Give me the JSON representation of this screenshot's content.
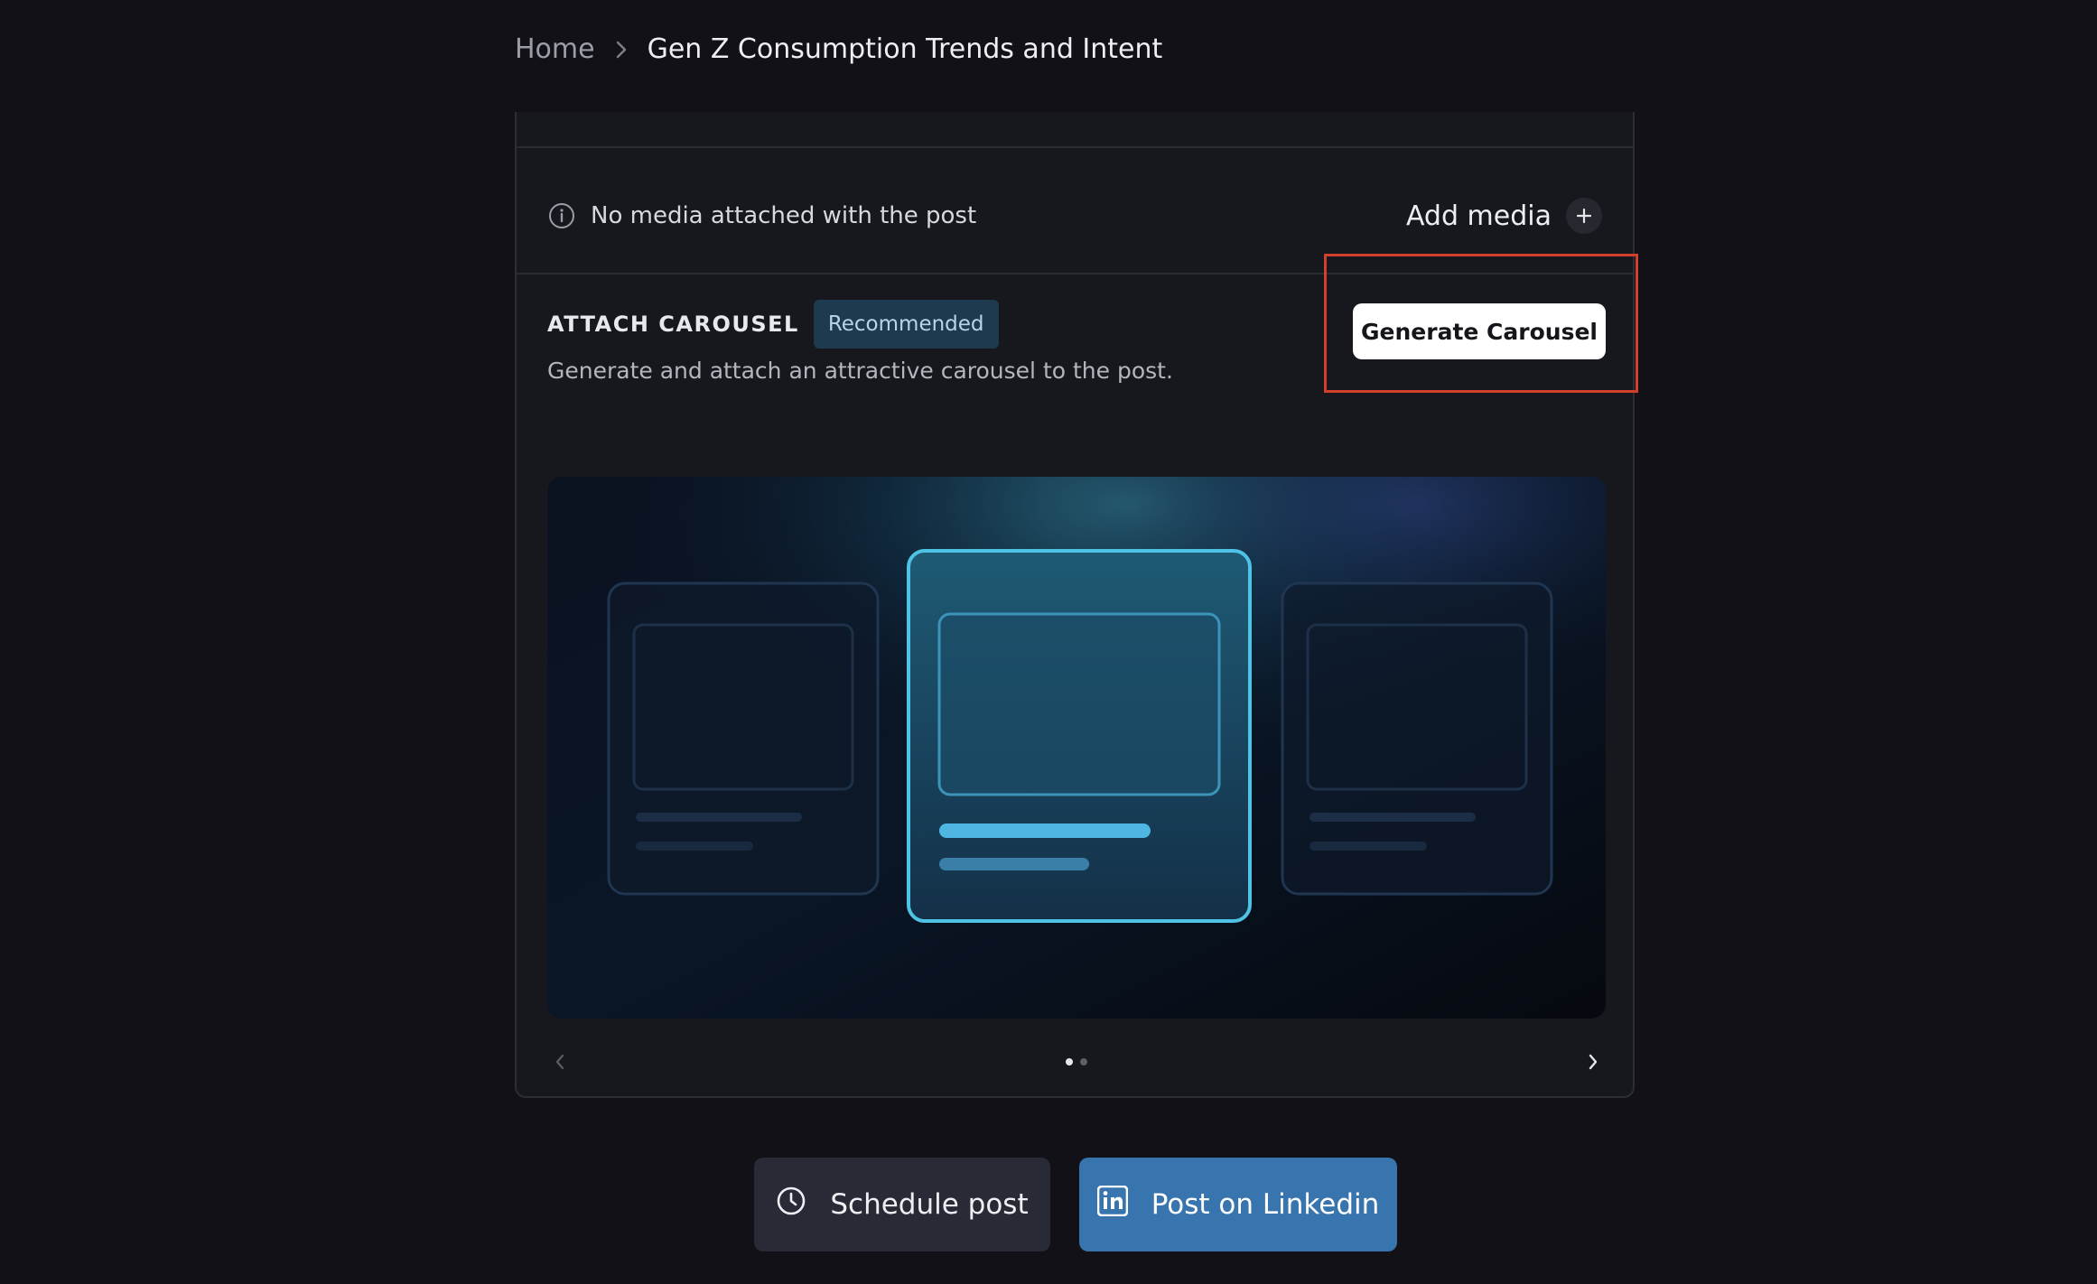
{
  "breadcrumb": {
    "home": "Home",
    "current": "Gen Z Consumption Trends and Intent"
  },
  "media": {
    "notice": "No media attached with the post",
    "add_label": "Add media"
  },
  "carousel": {
    "title": "ATTACH CAROUSEL",
    "badge": "Recommended",
    "description": "Generate and attach an attractive carousel to the post.",
    "generate_label": "Generate Carousel",
    "pages_total": 2,
    "page_current": 1
  },
  "actions": {
    "schedule_label": "Schedule post",
    "linkedin_label": "Post on Linkedin"
  },
  "icons": {
    "breadcrumb_separator": "chevron-right-icon",
    "media_notice": "info-icon",
    "add_media": "plus-icon",
    "prev": "chevron-left-icon",
    "next": "chevron-right-icon",
    "schedule": "clock-icon",
    "linkedin": "linkedin-icon"
  },
  "colors": {
    "background": "#111117",
    "card": "#17181e",
    "badge_bg": "#1e3a4f",
    "highlight": "#d2402c",
    "linkedin_button": "#3874ad",
    "schedule_button": "#282a36",
    "accent_cyan": "#4fc3e6"
  }
}
